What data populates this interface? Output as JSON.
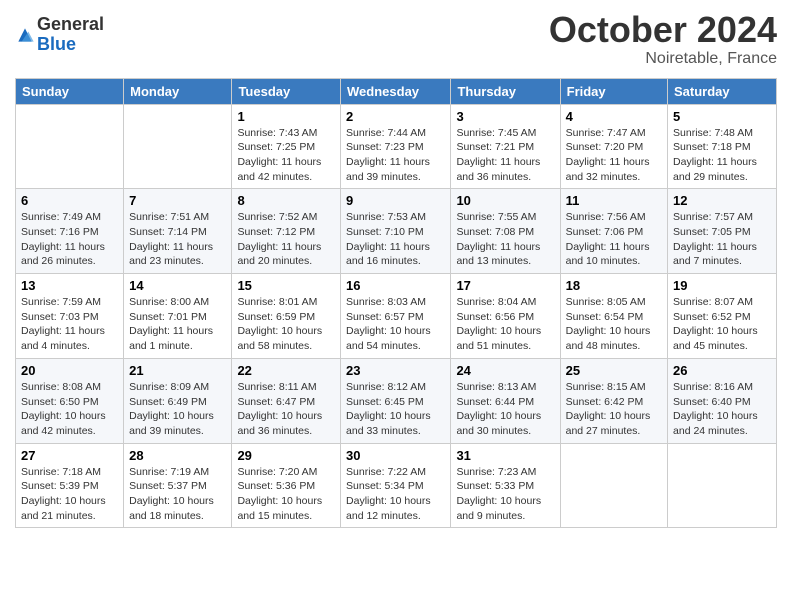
{
  "header": {
    "logo_general": "General",
    "logo_blue": "Blue",
    "month": "October 2024",
    "location": "Noiretable, France"
  },
  "weekdays": [
    "Sunday",
    "Monday",
    "Tuesday",
    "Wednesday",
    "Thursday",
    "Friday",
    "Saturday"
  ],
  "weeks": [
    [
      {
        "day": "",
        "info": ""
      },
      {
        "day": "",
        "info": ""
      },
      {
        "day": "1",
        "info": "Sunrise: 7:43 AM\nSunset: 7:25 PM\nDaylight: 11 hours and 42 minutes."
      },
      {
        "day": "2",
        "info": "Sunrise: 7:44 AM\nSunset: 7:23 PM\nDaylight: 11 hours and 39 minutes."
      },
      {
        "day": "3",
        "info": "Sunrise: 7:45 AM\nSunset: 7:21 PM\nDaylight: 11 hours and 36 minutes."
      },
      {
        "day": "4",
        "info": "Sunrise: 7:47 AM\nSunset: 7:20 PM\nDaylight: 11 hours and 32 minutes."
      },
      {
        "day": "5",
        "info": "Sunrise: 7:48 AM\nSunset: 7:18 PM\nDaylight: 11 hours and 29 minutes."
      }
    ],
    [
      {
        "day": "6",
        "info": "Sunrise: 7:49 AM\nSunset: 7:16 PM\nDaylight: 11 hours and 26 minutes."
      },
      {
        "day": "7",
        "info": "Sunrise: 7:51 AM\nSunset: 7:14 PM\nDaylight: 11 hours and 23 minutes."
      },
      {
        "day": "8",
        "info": "Sunrise: 7:52 AM\nSunset: 7:12 PM\nDaylight: 11 hours and 20 minutes."
      },
      {
        "day": "9",
        "info": "Sunrise: 7:53 AM\nSunset: 7:10 PM\nDaylight: 11 hours and 16 minutes."
      },
      {
        "day": "10",
        "info": "Sunrise: 7:55 AM\nSunset: 7:08 PM\nDaylight: 11 hours and 13 minutes."
      },
      {
        "day": "11",
        "info": "Sunrise: 7:56 AM\nSunset: 7:06 PM\nDaylight: 11 hours and 10 minutes."
      },
      {
        "day": "12",
        "info": "Sunrise: 7:57 AM\nSunset: 7:05 PM\nDaylight: 11 hours and 7 minutes."
      }
    ],
    [
      {
        "day": "13",
        "info": "Sunrise: 7:59 AM\nSunset: 7:03 PM\nDaylight: 11 hours and 4 minutes."
      },
      {
        "day": "14",
        "info": "Sunrise: 8:00 AM\nSunset: 7:01 PM\nDaylight: 11 hours and 1 minute."
      },
      {
        "day": "15",
        "info": "Sunrise: 8:01 AM\nSunset: 6:59 PM\nDaylight: 10 hours and 58 minutes."
      },
      {
        "day": "16",
        "info": "Sunrise: 8:03 AM\nSunset: 6:57 PM\nDaylight: 10 hours and 54 minutes."
      },
      {
        "day": "17",
        "info": "Sunrise: 8:04 AM\nSunset: 6:56 PM\nDaylight: 10 hours and 51 minutes."
      },
      {
        "day": "18",
        "info": "Sunrise: 8:05 AM\nSunset: 6:54 PM\nDaylight: 10 hours and 48 minutes."
      },
      {
        "day": "19",
        "info": "Sunrise: 8:07 AM\nSunset: 6:52 PM\nDaylight: 10 hours and 45 minutes."
      }
    ],
    [
      {
        "day": "20",
        "info": "Sunrise: 8:08 AM\nSunset: 6:50 PM\nDaylight: 10 hours and 42 minutes."
      },
      {
        "day": "21",
        "info": "Sunrise: 8:09 AM\nSunset: 6:49 PM\nDaylight: 10 hours and 39 minutes."
      },
      {
        "day": "22",
        "info": "Sunrise: 8:11 AM\nSunset: 6:47 PM\nDaylight: 10 hours and 36 minutes."
      },
      {
        "day": "23",
        "info": "Sunrise: 8:12 AM\nSunset: 6:45 PM\nDaylight: 10 hours and 33 minutes."
      },
      {
        "day": "24",
        "info": "Sunrise: 8:13 AM\nSunset: 6:44 PM\nDaylight: 10 hours and 30 minutes."
      },
      {
        "day": "25",
        "info": "Sunrise: 8:15 AM\nSunset: 6:42 PM\nDaylight: 10 hours and 27 minutes."
      },
      {
        "day": "26",
        "info": "Sunrise: 8:16 AM\nSunset: 6:40 PM\nDaylight: 10 hours and 24 minutes."
      }
    ],
    [
      {
        "day": "27",
        "info": "Sunrise: 7:18 AM\nSunset: 5:39 PM\nDaylight: 10 hours and 21 minutes."
      },
      {
        "day": "28",
        "info": "Sunrise: 7:19 AM\nSunset: 5:37 PM\nDaylight: 10 hours and 18 minutes."
      },
      {
        "day": "29",
        "info": "Sunrise: 7:20 AM\nSunset: 5:36 PM\nDaylight: 10 hours and 15 minutes."
      },
      {
        "day": "30",
        "info": "Sunrise: 7:22 AM\nSunset: 5:34 PM\nDaylight: 10 hours and 12 minutes."
      },
      {
        "day": "31",
        "info": "Sunrise: 7:23 AM\nSunset: 5:33 PM\nDaylight: 10 hours and 9 minutes."
      },
      {
        "day": "",
        "info": ""
      },
      {
        "day": "",
        "info": ""
      }
    ]
  ]
}
